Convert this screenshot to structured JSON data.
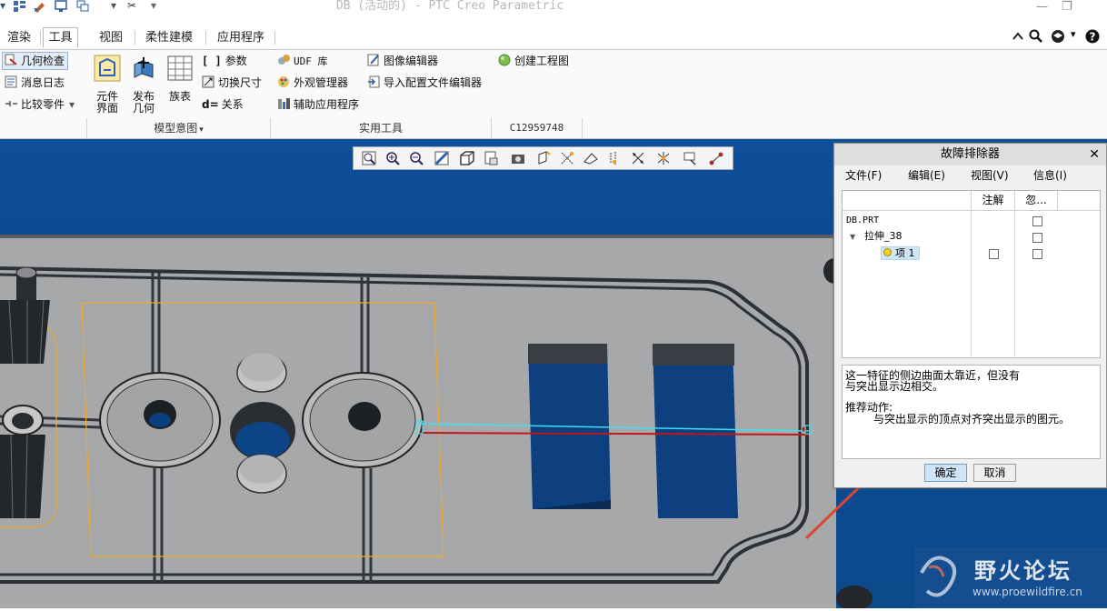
{
  "window": {
    "title": "DB (活动的) - PTC Creo Parametric",
    "minimize_glyph": "—",
    "restore_glyph": "❐"
  },
  "quick_access": {
    "icons": [
      "regenerate-icon",
      "edit-icon",
      "windows-icon",
      "close-window-icon",
      "more-icon"
    ]
  },
  "tabs": [
    {
      "label": "渲染"
    },
    {
      "label": "工具",
      "active": true
    },
    {
      "label": "视图"
    },
    {
      "label": "柔性建模"
    },
    {
      "label": "应用程序"
    }
  ],
  "ribbon": {
    "investigate": {
      "items": [
        {
          "label": "几何检查",
          "icon": "geometry-check-icon"
        },
        {
          "label": "消息日志",
          "icon": "message-log-icon"
        },
        {
          "label": "比较零件",
          "icon": "compare-part-icon"
        }
      ]
    },
    "model_intent": {
      "label": "模型意图",
      "buttons": [
        {
          "label_line1": "元件",
          "label_line2": "界面",
          "icon": "component-interface-icon"
        },
        {
          "label_line1": "发布",
          "label_line2": "几何",
          "icon": "publish-geometry-icon"
        },
        {
          "label_line1": "族表",
          "label_line2": "",
          "icon": "family-table-icon"
        }
      ],
      "small": [
        {
          "label": "参数",
          "prefix": "[ ]",
          "icon": "parameters-icon"
        },
        {
          "label": "切换尺寸",
          "icon": "switch-dimensions-icon"
        },
        {
          "label": "关系",
          "prefix": "d=",
          "icon": "relations-icon"
        }
      ]
    },
    "utilities": {
      "label": "实用工具",
      "items": [
        {
          "label": "UDF 库",
          "icon": "udf-library-icon"
        },
        {
          "label": "外观管理器",
          "icon": "appearance-manager-icon"
        },
        {
          "label": "辅助应用程序",
          "icon": "auxiliary-app-icon"
        },
        {
          "label": "图像编辑器",
          "icon": "image-editor-icon"
        },
        {
          "label": "导入配置文件编辑器",
          "icon": "import-config-editor-icon"
        }
      ]
    },
    "drawing": {
      "label": "C12959748",
      "items": [
        {
          "label": "创建工程图",
          "icon": "create-drawing-icon"
        }
      ]
    }
  },
  "view_toolbar": {
    "icons": [
      "refit-icon",
      "zoom-in-icon",
      "zoom-out-icon",
      "repaint-icon",
      "display-style-icon",
      "saved-orientations-icon",
      "view-manager-icon",
      "perspective-icon",
      "datum-planes-icon",
      "datum-axes-icon",
      "point-display-icon",
      "csys-display-icon",
      "spin-center-icon",
      "annotation-display-icon",
      "more-display-icon"
    ]
  },
  "troubleshooter": {
    "title": "故障排除器",
    "close_glyph": "✕",
    "menu": [
      {
        "label": "文件(F)"
      },
      {
        "label": "编辑(E)"
      },
      {
        "label": "视图(V)"
      },
      {
        "label": "信息(I)"
      }
    ],
    "columns": {
      "note": "注解",
      "ignore": "忽..."
    },
    "tree": [
      {
        "label": "DB.PRT",
        "level": 0
      },
      {
        "label": "拉伸_38",
        "level": 1,
        "expand_glyph": "▼"
      },
      {
        "label": "项 1",
        "level": 2,
        "selected": true
      }
    ],
    "message": {
      "line1": "这一特征的侧边曲面太靠近，但没有",
      "line2": "与突出显示边相交。",
      "action_title": "推荐动作:",
      "action_text": "与突出显示的顶点对齐突出显示的图元。"
    },
    "ok_label": "确定",
    "cancel_label": "取消"
  },
  "watermark": {
    "name": "野火论坛",
    "url": "www.proewildfire.cn"
  },
  "colors": {
    "viewport_blue": "#0b4b92",
    "model_gray": "#a9abad",
    "highlight_cyan": "#41e0f0",
    "highlight_red": "#c01818",
    "arrow_red": "#e0452e",
    "outline_orange": "#f0a830"
  }
}
